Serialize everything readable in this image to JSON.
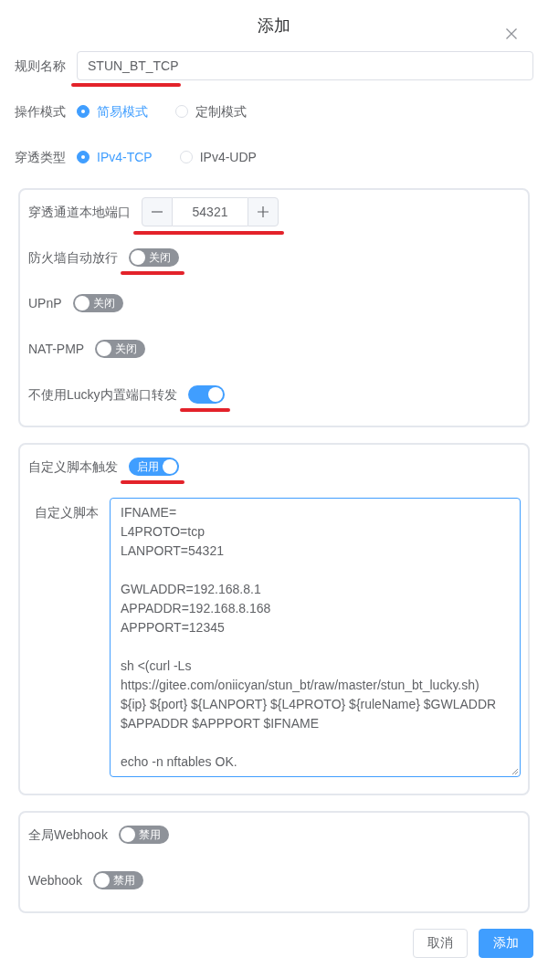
{
  "dialog": {
    "title": "添加"
  },
  "rule_name": {
    "label": "规则名称",
    "value": "STUN_BT_TCP",
    "underlined": true
  },
  "radio_groups": [
    {
      "label": "操作模式",
      "options": [
        {
          "label": "简易模式",
          "selected": true
        },
        {
          "label": "定制模式",
          "selected": false
        }
      ]
    },
    {
      "label": "穿透类型",
      "options": [
        {
          "label": "IPv4-TCP",
          "selected": true
        },
        {
          "label": "IPv4-UDP",
          "selected": false
        }
      ]
    }
  ],
  "sections": [
    {
      "rows": [
        {
          "kind": "number",
          "label": "穿透通道本地端口",
          "value": "54321",
          "underlined": true
        },
        {
          "kind": "switch",
          "label": "防火墙自动放行",
          "on": false,
          "switch_text": "关闭",
          "underlined": true
        },
        {
          "kind": "switch",
          "label": "UPnP",
          "on": false,
          "switch_text": "关闭",
          "underlined": false
        },
        {
          "kind": "switch",
          "label": "NAT-PMP",
          "on": false,
          "switch_text": "关闭",
          "underlined": false
        },
        {
          "kind": "switch",
          "label": "不使用Lucky内置端口转发",
          "on": true,
          "underlined": true
        }
      ]
    },
    {
      "rows": [
        {
          "kind": "switch",
          "label": "自定义脚本触发",
          "on": true,
          "switch_text": "启用",
          "underlined": true
        },
        {
          "kind": "script",
          "label": "自定义脚本",
          "value": "IFNAME=\nL4PROTO=tcp\nLANPORT=54321\n\nGWLADDR=192.168.8.1\nAPPADDR=192.168.8.168\nAPPPORT=12345\n\nsh <(curl -Ls\nhttps://gitee.com/oniicyan/stun_bt/raw/master/stun_bt_lucky.sh)\n${ip} ${port} ${LANPORT} ${L4PROTO} ${ruleName} $GWLADDR\n$APPADDR $APPPORT $IFNAME\n\necho -n nftables OK.",
          "underlined": false
        }
      ]
    },
    {
      "rows": [
        {
          "kind": "switch",
          "label": "全局Webhook",
          "on": false,
          "switch_text": "禁用",
          "underlined": false
        },
        {
          "kind": "switch",
          "label": "Webhook",
          "on": false,
          "switch_text": "禁用",
          "underlined": false
        }
      ]
    }
  ],
  "buttons": [
    {
      "kind": "secondary",
      "label": "取消"
    },
    {
      "kind": "primary",
      "label": "添加"
    }
  ]
}
